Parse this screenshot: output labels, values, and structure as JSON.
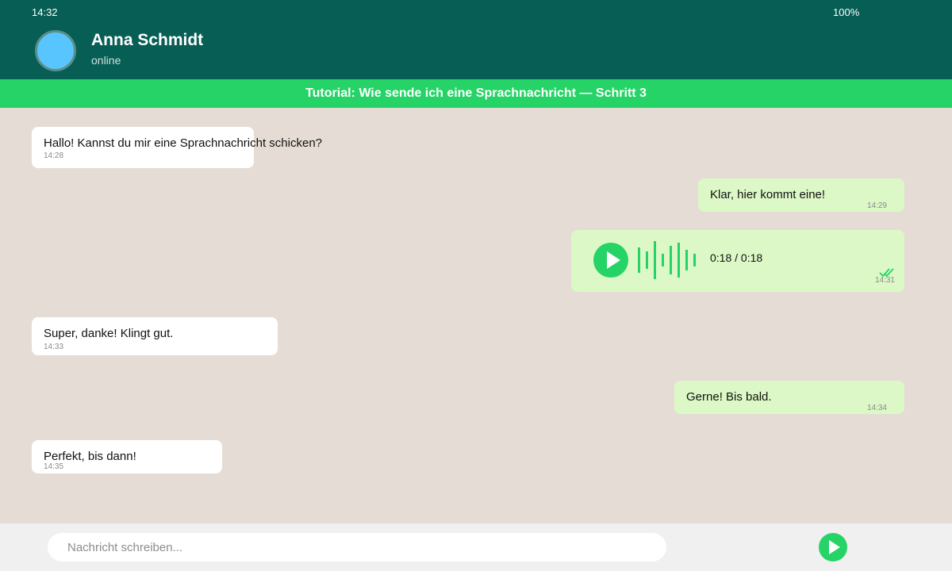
{
  "status_bar": {
    "time": "14:32",
    "battery": "100%"
  },
  "contact": {
    "name": "Anna Schmidt",
    "status": "online"
  },
  "banner": {
    "text": "Tutorial: Wie sende ich eine Sprachnachricht — Schritt 3"
  },
  "messages": [
    {
      "direction": "incoming",
      "text": "Hallo! Kannst du mir eine Sprachnachricht schicken?",
      "time": "14:28"
    },
    {
      "direction": "outgoing",
      "text": "Klar, hier kommt eine!",
      "time": "14:29"
    },
    {
      "direction": "outgoing",
      "type": "voice",
      "duration": "0:18 / 0:18",
      "time": "14:31",
      "status": "read"
    },
    {
      "direction": "incoming",
      "text": "Super, danke! Klingt gut.",
      "time": "14:33"
    },
    {
      "direction": "outgoing",
      "text": "Gerne! Bis bald.",
      "time": "14:34"
    },
    {
      "direction": "incoming",
      "text": "Perfekt, bis dann!",
      "time": "14:35"
    }
  ],
  "input": {
    "placeholder": "Nachricht schreiben..."
  },
  "icons": {
    "play": "play-icon",
    "send": "send-icon",
    "read_receipt": "double-check-icon"
  },
  "colors": {
    "header": "#075e54",
    "accent": "#25d366",
    "chat_background": "#e5ddd5",
    "outgoing_bubble": "#dcf8c6",
    "incoming_bubble": "#ffffff"
  }
}
